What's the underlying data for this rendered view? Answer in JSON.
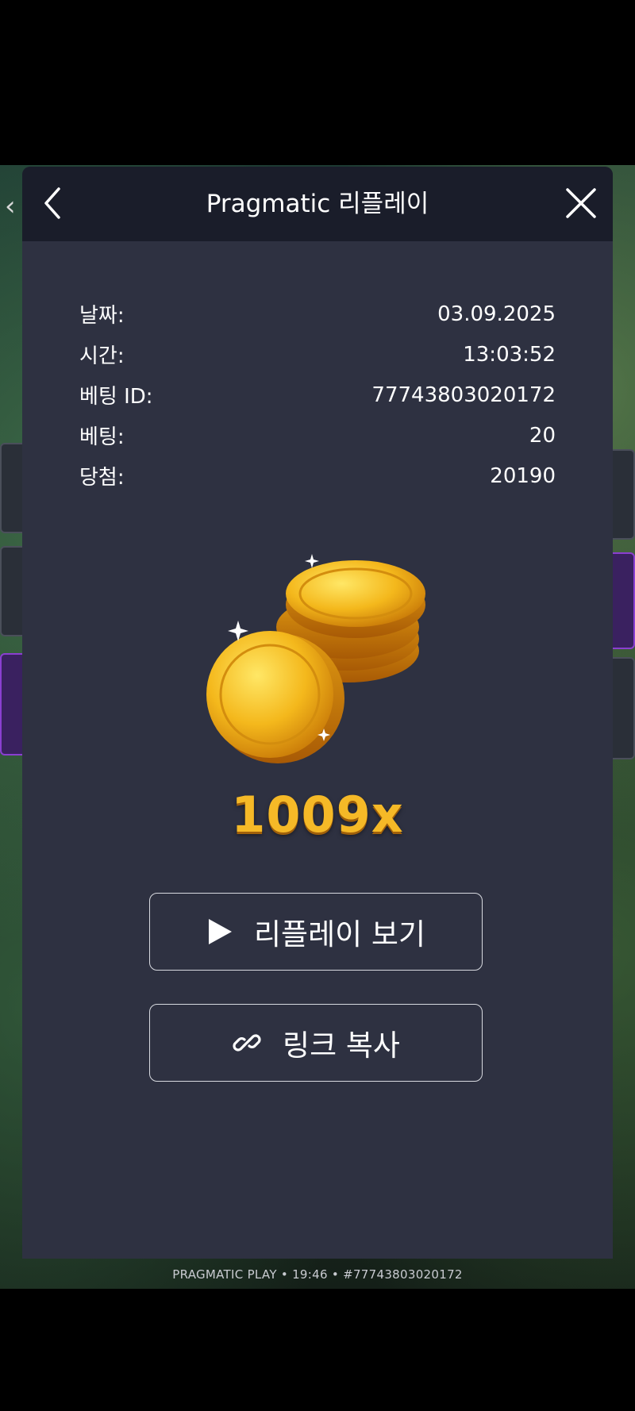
{
  "header": {
    "title": "Pragmatic 리플레이",
    "back_icon": "chevron-left-icon",
    "close_icon": "close-icon"
  },
  "info": [
    {
      "label": "날짜:",
      "value": "03.09.2025"
    },
    {
      "label": "시간:",
      "value": "13:03:52"
    },
    {
      "label": "베팅 ID:",
      "value": "77743803020172"
    },
    {
      "label": "베팅:",
      "value": "20"
    },
    {
      "label": "당첨:",
      "value": "20190"
    }
  ],
  "win": {
    "multiplier": "1009x",
    "image": "gold-coins-stack"
  },
  "buttons": {
    "replay_label": "리플레이 보기",
    "replay_icon": "play-icon",
    "copy_label": "링크 복사",
    "copy_icon": "link-icon"
  },
  "background": {
    "footer_text": "PRAGMATIC PLAY • 19:46 • #77743803020172",
    "back_icon": "chevron-left-icon"
  },
  "colors": {
    "modal_bg": "#2e3141",
    "header_bg": "#1a1d2a",
    "multiplier": "#f5b927"
  }
}
